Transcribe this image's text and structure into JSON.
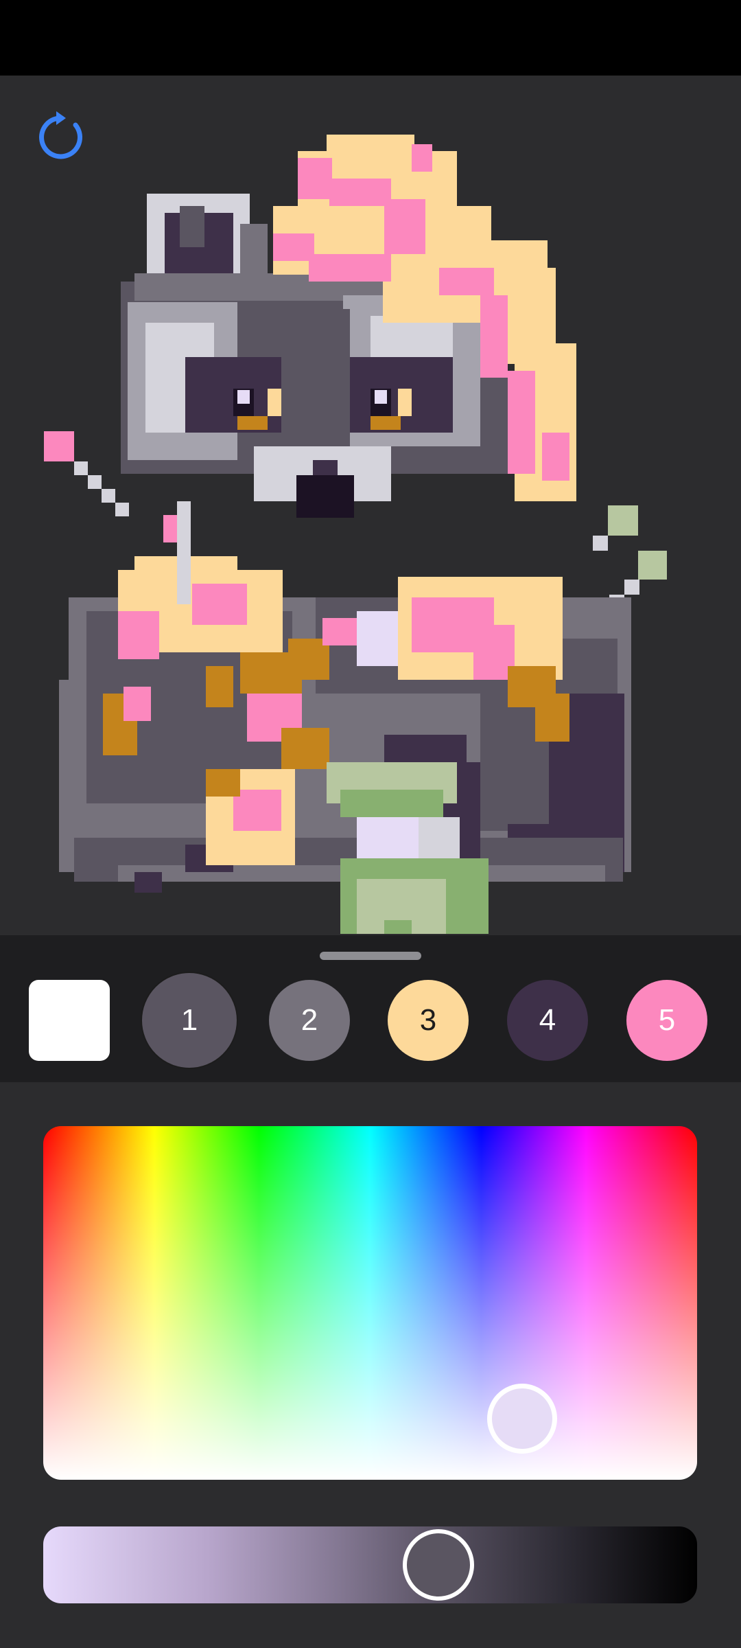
{
  "palette": {
    "blank_swatch_color": "#ffffff",
    "swatches": [
      {
        "label": "1",
        "color": "#5a5561",
        "text_color": "#ffffff",
        "selected": true
      },
      {
        "label": "2",
        "color": "#76727c",
        "text_color": "#ffffff",
        "selected": false
      },
      {
        "label": "3",
        "color": "#fdd99a",
        "text_color": "#1c1c1c",
        "selected": false
      },
      {
        "label": "4",
        "color": "#3e3049",
        "text_color": "#ffffff",
        "selected": false
      },
      {
        "label": "5",
        "color": "#fc88be",
        "text_color": "#ffffff",
        "selected": false
      }
    ]
  },
  "icons": {
    "reset": "refresh-icon",
    "handle": "drag-handle"
  },
  "picker": {
    "sv_selected_color": "#e6dcf6",
    "value_selected_color": "#5a5561"
  },
  "colors": {
    "accent": "#3b82f6",
    "status_bar": "#000000",
    "background": "#2c2c2e",
    "palette_bar": "#1e1e20"
  }
}
